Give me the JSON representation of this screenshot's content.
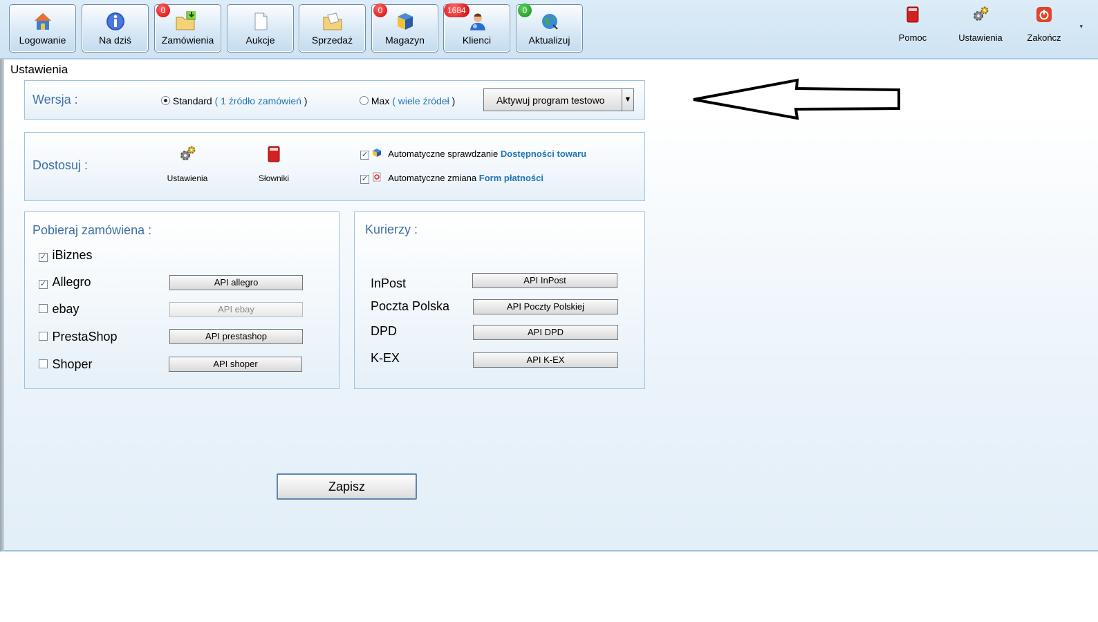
{
  "toolbar": {
    "buttons": [
      {
        "label": "Logowanie",
        "icon": "house-icon",
        "badge": ""
      },
      {
        "label": "Na dziś",
        "icon": "info-icon",
        "badge": ""
      },
      {
        "label": "Zamówienia",
        "icon": "folder-download-icon",
        "badge": "0"
      },
      {
        "label": "Aukcje",
        "icon": "document-icon",
        "badge": ""
      },
      {
        "label": "Sprzedaż",
        "icon": "folder-icon",
        "badge": ""
      },
      {
        "label": "Magazyn",
        "icon": "box-icon",
        "badge": "0"
      },
      {
        "label": "Klienci",
        "icon": "user-icon",
        "badge": "1684"
      },
      {
        "label": "Aktualizuj",
        "icon": "globe-icon",
        "badge": "0"
      }
    ],
    "right": [
      {
        "label": "Pomoc",
        "icon": "book-icon"
      },
      {
        "label": "Ustawienia",
        "icon": "gears-icon"
      },
      {
        "label": "Zakończ",
        "icon": "power-icon"
      }
    ]
  },
  "page": {
    "title": "Ustawienia"
  },
  "wersja": {
    "title": "Wersja :",
    "standard_label": "Standard",
    "standard_open": "(",
    "standard_link": "1 źródło zamówień",
    "standard_close": ")",
    "max_label": "Max",
    "max_open": "(",
    "max_link": "wiele źródeł",
    "max_close": ")",
    "dropdown_label": "Aktywuj program testowo",
    "selected": "standard"
  },
  "dostosuj": {
    "title": "Dostosuj :",
    "ustawienia_label": "Ustawienia",
    "slowniki_label": "Słowniki",
    "auto1_text": "Automatyczne sprawdzanie",
    "auto1_link": "Dostępności towaru",
    "auto2_text": "Automatyczne zmiana",
    "auto2_link": "Form płatności"
  },
  "pobieraj": {
    "title": "Pobieraj zamówiena :",
    "items": [
      {
        "label": "iBiznes",
        "checked": true,
        "api": ""
      },
      {
        "label": "Allegro",
        "checked": true,
        "api": "API allegro"
      },
      {
        "label": "ebay",
        "checked": false,
        "api": "API ebay"
      },
      {
        "label": "PrestaShop",
        "checked": false,
        "api": "API prestashop"
      },
      {
        "label": "Shoper",
        "checked": false,
        "api": "API shoper"
      }
    ]
  },
  "kurierzy": {
    "title": "Kurierzy :",
    "items": [
      {
        "label": "InPost",
        "api": "API InPost"
      },
      {
        "label": "Poczta Polska",
        "api": "API Poczty Polskiej"
      },
      {
        "label": "DPD",
        "api": "API DPD"
      },
      {
        "label": "K-EX",
        "api": "API K-EX"
      }
    ]
  },
  "save_label": "Zapisz",
  "colors": {
    "title_blue": "#3d6fa6",
    "link_blue": "#1d75b3",
    "badge_red": "#d40000",
    "badge_green": "#1c8a1c"
  }
}
